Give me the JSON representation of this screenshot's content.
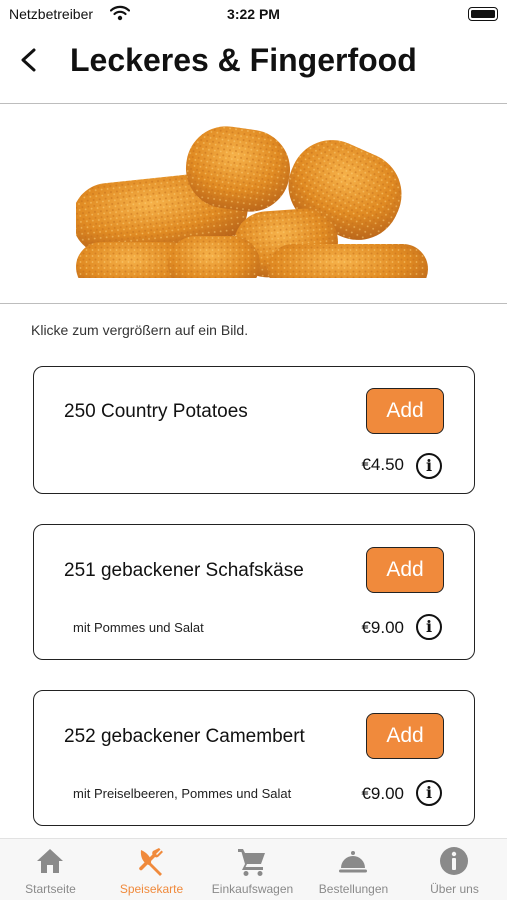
{
  "status_bar": {
    "carrier": "Netzbetreiber",
    "time": "3:22 PM"
  },
  "header": {
    "title": "Leckeres & Fingerfood"
  },
  "hint": "Klicke zum vergrößern auf ein Bild.",
  "items": [
    {
      "title": "250 Country Potatoes",
      "subtitle": "",
      "price": "€4.50",
      "add_label": "Add"
    },
    {
      "title": "251 gebackener Schafskäse",
      "subtitle": "mit Pommes und Salat",
      "price": "€9.00",
      "add_label": "Add"
    },
    {
      "title": "252 gebackener Camembert",
      "subtitle": "mit Preiselbeeren, Pommes und Salat",
      "price": "€9.00",
      "add_label": "Add"
    }
  ],
  "tabs": [
    {
      "label": "Startseite",
      "icon": "home-icon"
    },
    {
      "label": "Speisekarte",
      "icon": "fork-knife-icon",
      "active": true
    },
    {
      "label": "Einkaufswagen",
      "icon": "cart-icon"
    },
    {
      "label": "Bestellungen",
      "icon": "cloche-icon"
    },
    {
      "label": "Über uns",
      "icon": "info-icon"
    }
  ],
  "colors": {
    "accent": "#f08a3c",
    "tab_inactive": "#8a8a8a"
  }
}
